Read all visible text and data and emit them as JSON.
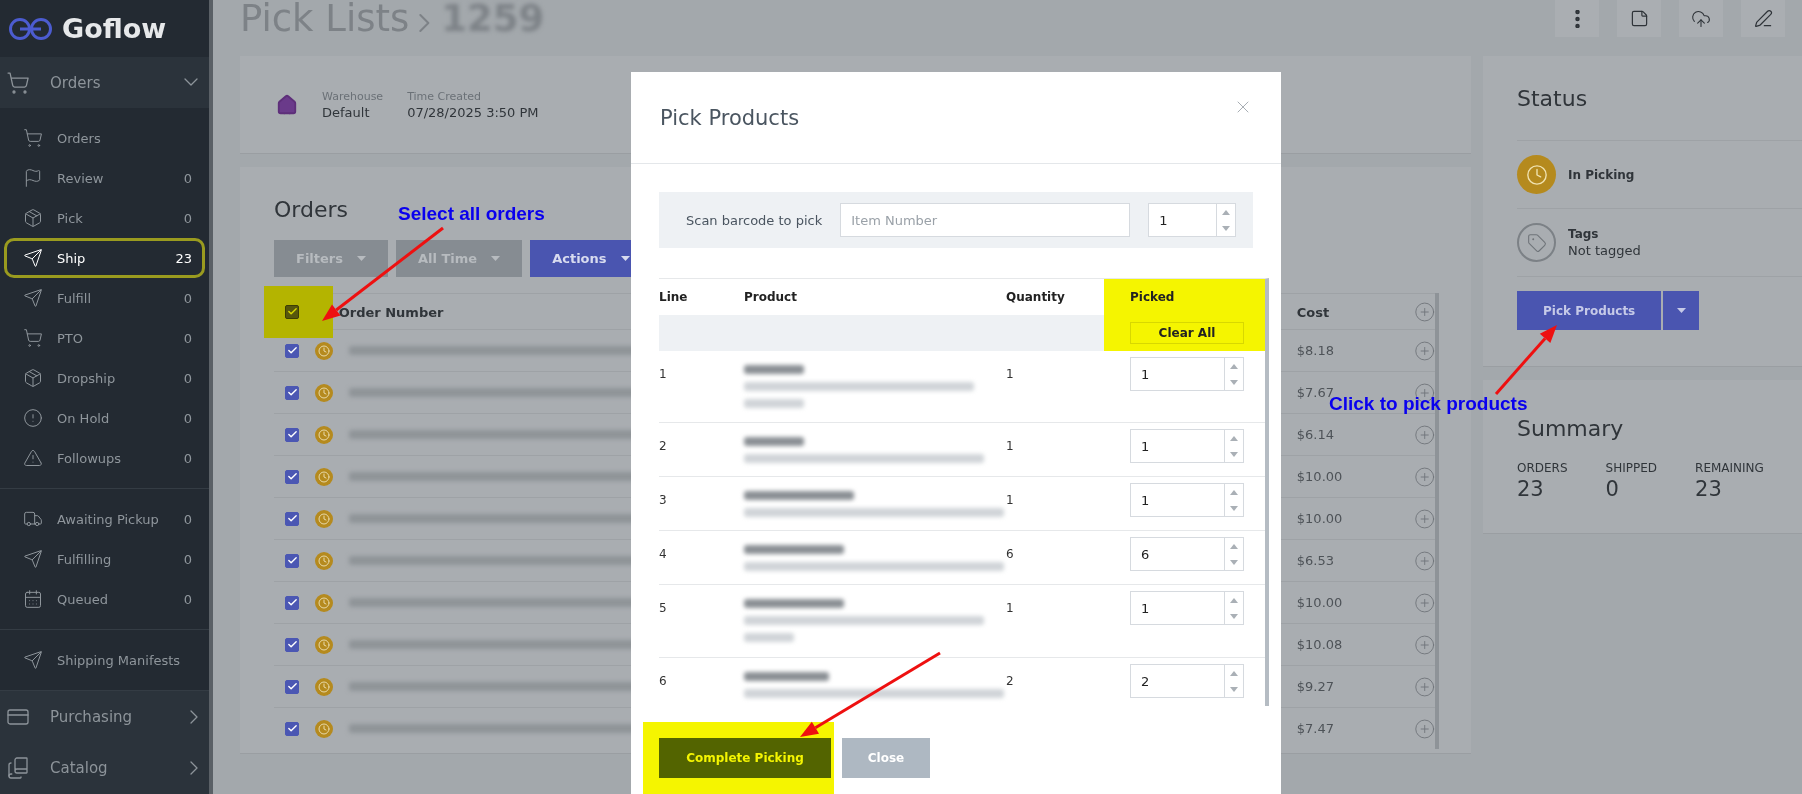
{
  "sidebar": {
    "logo": "Goflow",
    "sections": [
      {
        "label": "Orders",
        "expanded": true,
        "groups": [
          {
            "items": [
              {
                "label": "Orders",
                "selected": false
              },
              {
                "label": "Review",
                "count": "0",
                "selected": false
              },
              {
                "label": "Pick",
                "count": "0",
                "selected": false
              },
              {
                "label": "Ship",
                "count": "23",
                "selected": true
              },
              {
                "label": "Fulfill",
                "count": "0",
                "selected": false
              },
              {
                "label": "PTO",
                "count": "0",
                "selected": false
              },
              {
                "label": "Dropship",
                "count": "0",
                "selected": false
              },
              {
                "label": "On Hold",
                "count": "0",
                "selected": false
              },
              {
                "label": "Followups",
                "count": "0",
                "selected": false
              }
            ]
          },
          {
            "items": [
              {
                "label": "Awaiting Pickup",
                "count": "0",
                "selected": false
              },
              {
                "label": "Fulfilling",
                "count": "0",
                "selected": false
              },
              {
                "label": "Queued",
                "count": "0",
                "selected": false
              }
            ]
          },
          {
            "items": [
              {
                "label": "Shipping Manifests",
                "selected": false
              }
            ]
          }
        ]
      },
      {
        "label": "Purchasing",
        "expanded": false
      },
      {
        "label": "Catalog",
        "expanded": false
      }
    ]
  },
  "header": {
    "breadcrumb": [
      "Pick Lists",
      "1259"
    ]
  },
  "info": {
    "warehouse_label": "Warehouse",
    "warehouse": "Default",
    "time_label": "Time Created",
    "time": "07/28/2025 3:50 PM"
  },
  "orders": {
    "title": "Orders",
    "buttons": [
      "Filters",
      "All Time",
      "Actions"
    ],
    "select_all_checked": true,
    "columns": [
      "Order Number",
      "Cost"
    ],
    "rows": [
      {
        "checked": true,
        "cost": "$8.18"
      },
      {
        "checked": true,
        "cost": "$7.67"
      },
      {
        "checked": true,
        "cost": "$6.14"
      },
      {
        "checked": true,
        "cost": "$10.00"
      },
      {
        "checked": true,
        "cost": "$10.00"
      },
      {
        "checked": true,
        "cost": "$6.53"
      },
      {
        "checked": true,
        "cost": "$10.00"
      },
      {
        "checked": true,
        "cost": "$10.08"
      },
      {
        "checked": true,
        "cost": "$9.27"
      },
      {
        "checked": true,
        "cost": "$7.47"
      }
    ]
  },
  "status": {
    "title": "Status",
    "state": "In Picking",
    "tags_label": "Tags",
    "tags_value": "Not tagged",
    "button": "Pick Products"
  },
  "summary": {
    "title": "Summary",
    "stats": [
      {
        "label": "ORDERS",
        "value": "23"
      },
      {
        "label": "SHIPPED",
        "value": "0"
      },
      {
        "label": "REMAINING",
        "value": "23"
      }
    ]
  },
  "modal": {
    "title": "Pick Products",
    "scan_label": "Scan barcode to pick",
    "placeholder": "Item Number",
    "scan_qty": "1",
    "columns": [
      "Line",
      "Product",
      "Quantity",
      "Picked"
    ],
    "clear_all": "Clear All",
    "lines": [
      {
        "line": "1",
        "quantity": "1",
        "picked": "1"
      },
      {
        "line": "2",
        "quantity": "1",
        "picked": "1"
      },
      {
        "line": "3",
        "quantity": "1",
        "picked": "1"
      },
      {
        "line": "4",
        "quantity": "6",
        "picked": "6"
      },
      {
        "line": "5",
        "quantity": "1",
        "picked": "1"
      },
      {
        "line": "6",
        "quantity": "2",
        "picked": "2"
      }
    ],
    "buttons": [
      "Complete Picking",
      "Close"
    ]
  },
  "annotations": [
    "Select all orders",
    "Click to pick products"
  ]
}
